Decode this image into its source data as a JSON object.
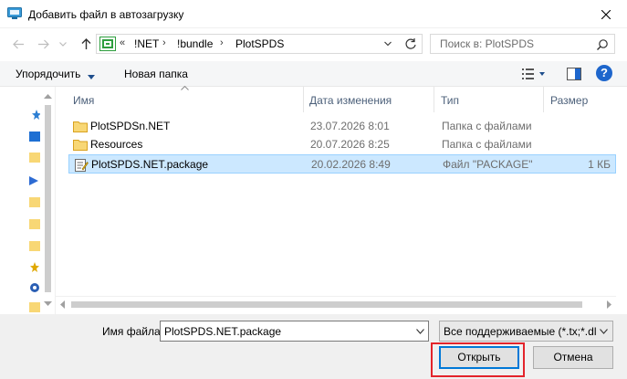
{
  "window": {
    "title": "Добавить файл в автозагрузку",
    "title_icon": "dialog-app-icon",
    "close_icon": "close-icon"
  },
  "nav": {
    "back_icon": "arrow-left-icon",
    "forward_icon": "arrow-right-icon",
    "recent_icon": "chevron-down-icon",
    "up_icon": "arrow-up-icon",
    "address": {
      "icon": "plotspds-folder-icon",
      "overflow": "«",
      "crumbs": [
        "!NET",
        "!bundle",
        "PlotSPDS"
      ],
      "separator": "›"
    },
    "search": {
      "placeholder": "Поиск в: PlotSPDS",
      "icon": "search-icon"
    }
  },
  "toolbar": {
    "organize_label": "Упорядочить",
    "new_folder_label": "Новая папка",
    "view_icon": "view-details-icon",
    "preview_icon": "preview-pane-icon",
    "help_label": "?"
  },
  "columns": {
    "name": "Имя",
    "date": "Дата изменения",
    "type": "Тип",
    "size": "Размер"
  },
  "files": [
    {
      "name": "PlotSPDSn.NET",
      "date": "23.07.2026 8:01",
      "type": "Папка с файлами",
      "size": "",
      "icon": "folder-icon",
      "selected": false
    },
    {
      "name": "Resources",
      "date": "20.07.2026 8:25",
      "type": "Папка с файлами",
      "size": "",
      "icon": "folder-icon",
      "selected": false
    },
    {
      "name": "PlotSPDS.NET.package",
      "date": "20.02.2026 8:49",
      "type": "Файл \"PACKAGE\"",
      "size": "1 КБ",
      "icon": "package-file-icon",
      "selected": true
    }
  ],
  "bottom": {
    "filename_label": "Имя файла:",
    "filename_value": "PlotSPDS.NET.package",
    "filetype_value": "Все поддерживаемые  (*.tx;*.dll;*",
    "open_label": "Открыть",
    "cancel_label": "Отмена"
  },
  "colors": {
    "accent": "#0078d7",
    "selection": "#cce8ff",
    "highlight_box": "#e3242b"
  }
}
